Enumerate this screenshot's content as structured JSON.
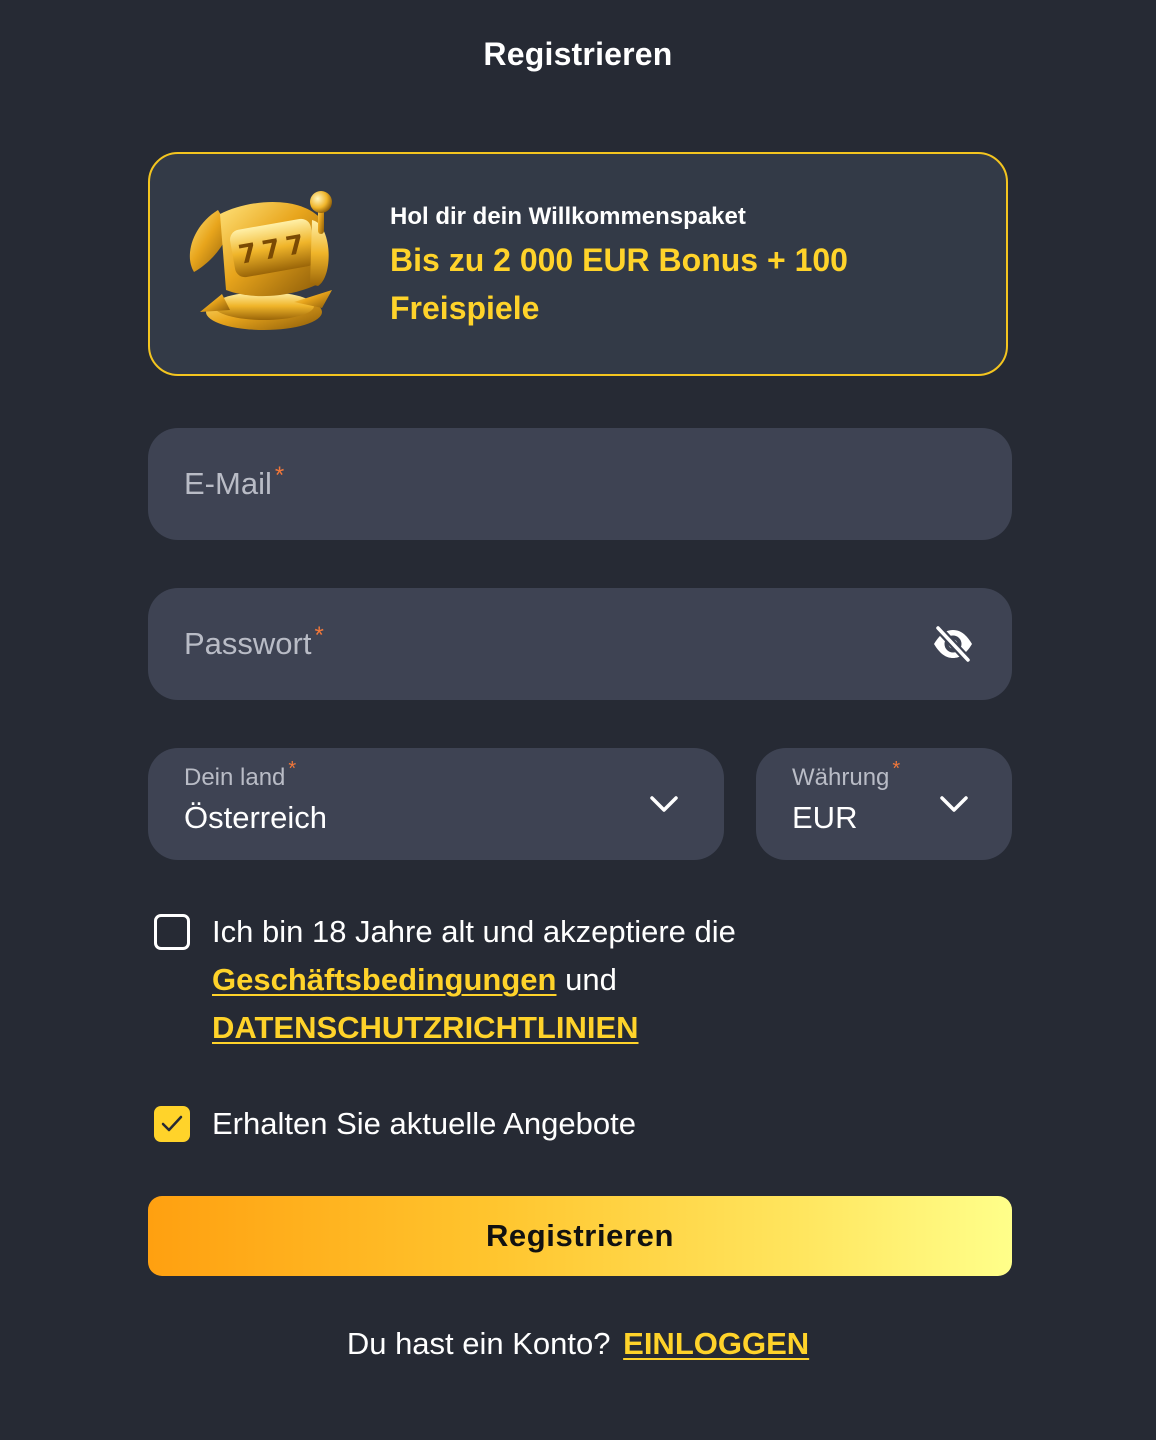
{
  "header": {
    "title": "Registrieren"
  },
  "promo": {
    "subtitle": "Hol dir dein Willkommenspaket",
    "headline": "Bis zu 2 000 EUR Bonus + 100 Freispiele",
    "image_icon": "golden-slot-machine-icon"
  },
  "form": {
    "email": {
      "placeholder": "E-Mail",
      "required_mark": "*",
      "value": ""
    },
    "password": {
      "placeholder": "Passwort",
      "required_mark": "*",
      "value": "",
      "toggle_icon": "eye-slash-icon"
    },
    "country": {
      "label": "Dein land",
      "required_mark": "*",
      "value": "Österreich",
      "icon": "chevron-down-icon"
    },
    "currency": {
      "label": "Währung",
      "required_mark": "*",
      "value": "EUR",
      "icon": "chevron-down-icon"
    },
    "terms": {
      "checked": false,
      "text_before": "Ich bin 18 Jahre alt und akzeptiere die",
      "terms_link": "Geschäftsbedingungen",
      "text_between": "und",
      "privacy_link": "DATENSCHUTZRICHTLINIEN"
    },
    "offers": {
      "checked": true,
      "text": "Erhalten Sie aktuelle Angebote"
    },
    "submit_label": "Registrieren"
  },
  "footer": {
    "text": "Du hast ein Konto?",
    "login_link": "EINLOGGEN"
  },
  "colors": {
    "background": "#262a34",
    "card": "#333a47",
    "field": "#3e4353",
    "accent": "#ffd32a",
    "required": "#f0773a",
    "button_gradient_start": "#ffa010",
    "button_gradient_end": "#ffff8a"
  }
}
